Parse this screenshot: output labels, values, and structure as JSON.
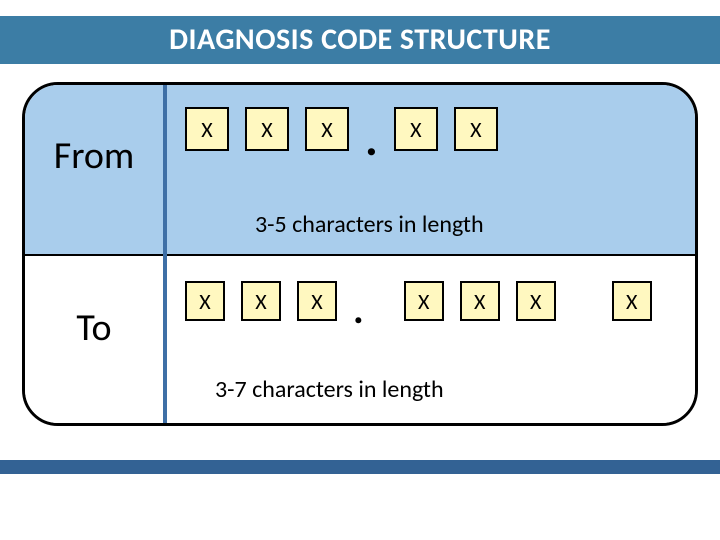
{
  "title": "DIAGNOSIS CODE STRUCTURE",
  "from": {
    "label": "From",
    "boxes": [
      "X",
      "X",
      "X",
      "X",
      "X"
    ],
    "dot_after_index": 3,
    "caption": "3-5 characters in length"
  },
  "to": {
    "label": "To",
    "boxes": [
      "X",
      "X",
      "X",
      "X",
      "X",
      "X",
      "X"
    ],
    "dot_after_index": 3,
    "caption": "3-7 characters in length"
  },
  "colors": {
    "title_bg": "#3c7da5",
    "top_panel": "#a9cdec",
    "box_fill": "#fff8c0",
    "footer": "#336294",
    "vline": "#3e6fa6"
  },
  "chart_data": {
    "type": "table",
    "title": "DIAGNOSIS CODE STRUCTURE",
    "rows": [
      {
        "label": "From",
        "pattern": "XXX.XX",
        "length_text": "3-5 characters in length",
        "min_chars": 3,
        "max_chars": 5
      },
      {
        "label": "To",
        "pattern": "XXX.XXXX",
        "length_text": "3-7 characters in length",
        "min_chars": 3,
        "max_chars": 7
      }
    ]
  }
}
